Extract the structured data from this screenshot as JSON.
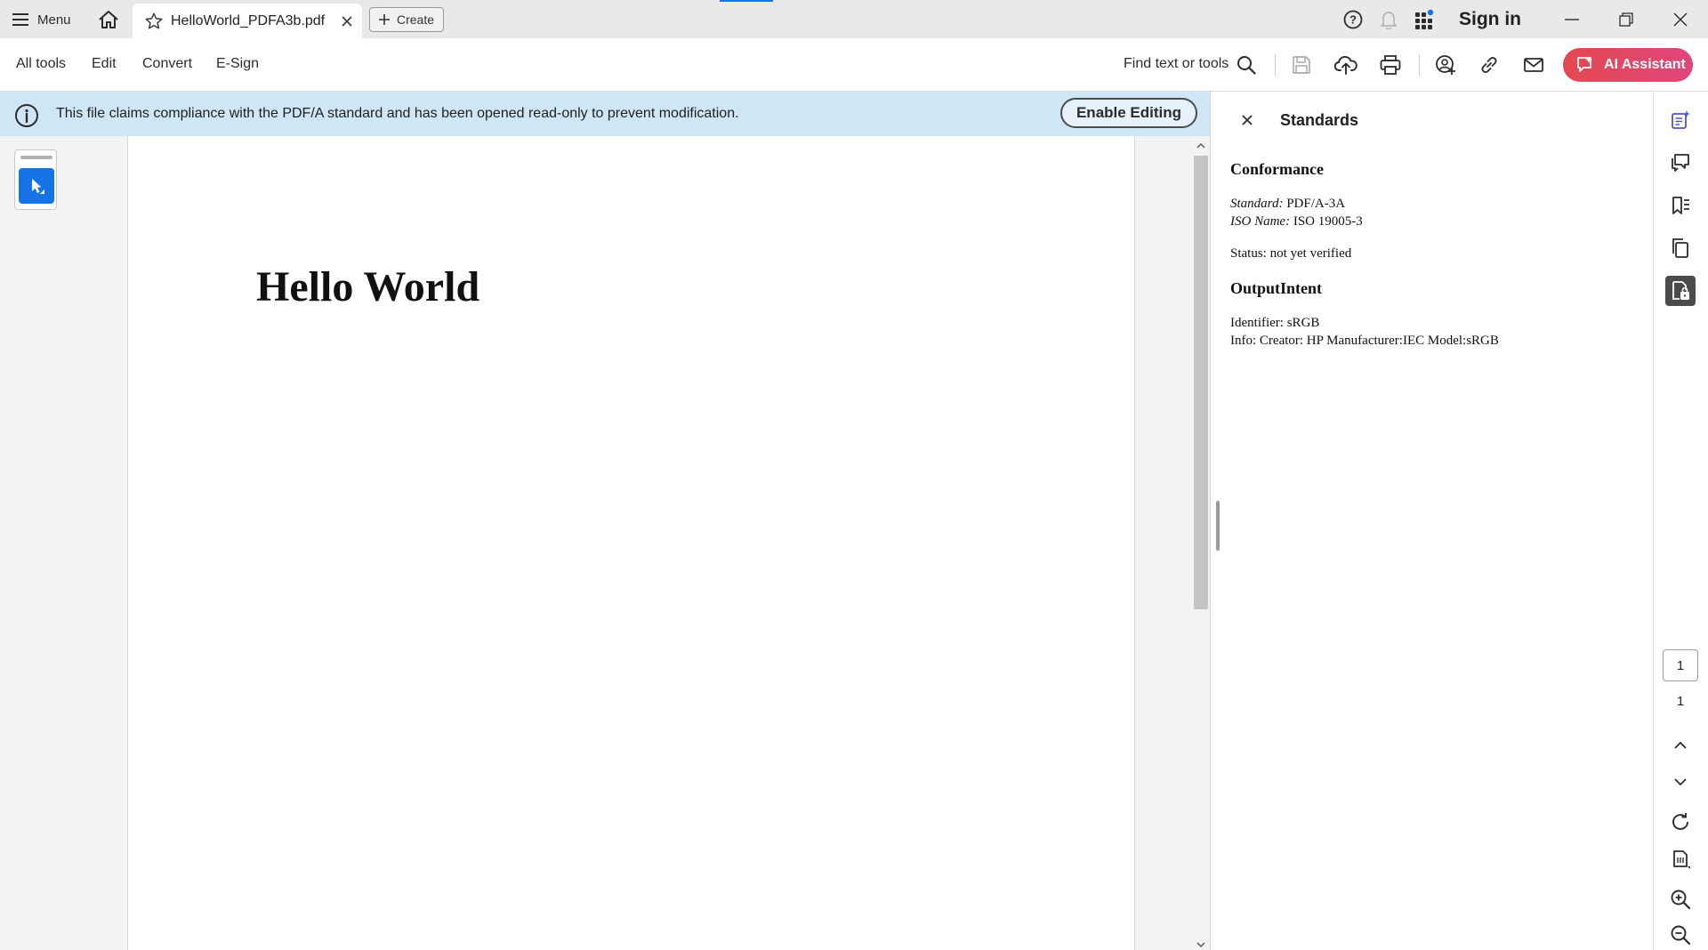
{
  "titlebar": {
    "menu_label": "Menu",
    "tab_title": "HelloWorld_PDFA3b.pdf",
    "create_label": "Create",
    "sign_in_label": "Sign in"
  },
  "toolbar": {
    "menu_items": [
      "All tools",
      "Edit",
      "Convert",
      "E-Sign"
    ],
    "find_label": "Find text or tools",
    "ai_label": "AI Assistant"
  },
  "banner": {
    "message": "This file claims compliance with the PDF/A standard and has been opened read-only to prevent modification.",
    "enable_label": "Enable Editing"
  },
  "document": {
    "heading": "Hello World"
  },
  "standards_panel": {
    "title": "Standards",
    "conformance_heading": "Conformance",
    "standard_label": "Standard:",
    "standard_value": "PDF/A-3A",
    "iso_label": "ISO Name:",
    "iso_value": "ISO 19005-3",
    "status": "Status: not yet verified",
    "output_heading": "OutputIntent",
    "identifier": "Identifier: sRGB",
    "info": "Info: Creator: HP Manufacturer:IEC Model:sRGB"
  },
  "pagination": {
    "current_page": "1",
    "total_pages": "1"
  },
  "colors": {
    "accent": "#1473e6",
    "banner_bg": "#cfe6f6",
    "ai_gradient_start": "#e34850",
    "ai_gradient_end": "#e0457b",
    "notification_dot": "#1473e6"
  }
}
